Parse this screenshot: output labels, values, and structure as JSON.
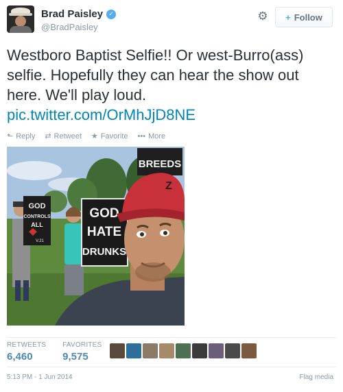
{
  "user": {
    "full_name": "Brad Paisley",
    "handle": "@BradPaisley",
    "verified_icon": "✓"
  },
  "buttons": {
    "follow_label": "Follow",
    "follow_icon": "+"
  },
  "tweet": {
    "text_line": "Westboro Baptist Selfie!! Or west-Burro(ass) selfie. Hopefully they can hear the show out here. We'll play loud.",
    "link": "pic.twitter.com/OrMhJjD8NE"
  },
  "actions": {
    "reply": "Reply",
    "retweet": "Retweet",
    "favorite": "Favorite",
    "more": "More"
  },
  "photo": {
    "sign_top": "BREEDS",
    "sign_left_1": "GOD",
    "sign_left_2": "CONTROLS",
    "sign_left_3": "ALL",
    "sign_left_4": "V.21",
    "sign_center_1": "GOD",
    "sign_center_2": "HATE",
    "sign_center_3": "DRUNKS",
    "cap_logo": "Z"
  },
  "stats": {
    "retweets_label": "RETWEETS",
    "retweets_value": "6,460",
    "favorites_label": "FAVORITES",
    "favorites_value": "9,575"
  },
  "favorer_colors": [
    "#5a4a3c",
    "#2d6f9a",
    "#8a7a66",
    "#a68a6a",
    "#4f6f55",
    "#3b3b3b",
    "#6b5e78",
    "#4a4a4a",
    "#7b5a3f"
  ],
  "footer": {
    "timestamp": "5:13 PM - 1 Jun 2014",
    "flag_media": "Flag media"
  },
  "colors": {
    "link": "#0084b4",
    "muted": "#8899a6",
    "verified": "#55acee"
  }
}
